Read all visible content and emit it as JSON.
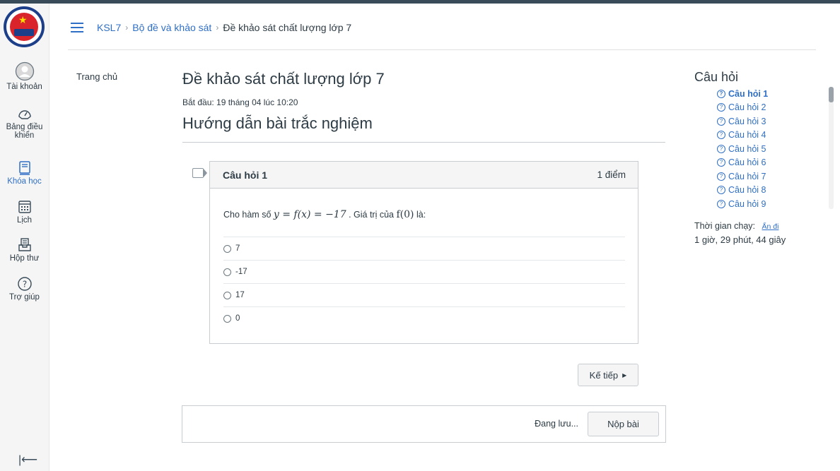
{
  "breadcrumb": {
    "course": "KSL7",
    "section": "Bộ đề và khảo sát",
    "current": "Đề khảo sát chất lượng lớp 7"
  },
  "global_nav": {
    "items": [
      {
        "label": "Tài khoản",
        "icon": "account-icon"
      },
      {
        "label": "Bảng điều khiển",
        "icon": "dashboard-icon"
      },
      {
        "label": "Khóa học",
        "icon": "courses-icon"
      },
      {
        "label": "Lịch",
        "icon": "calendar-icon"
      },
      {
        "label": "Hộp thư",
        "icon": "inbox-icon"
      },
      {
        "label": "Trợ giúp",
        "icon": "help-icon"
      }
    ],
    "active_color": "#2f6fc5"
  },
  "course_nav": {
    "home": "Trang chủ"
  },
  "quiz": {
    "title": "Đề khảo sát chất lượng lớp 7",
    "started": "Bắt đầu: 19 tháng 04 lúc 10:20",
    "instructions_heading": "Hướng dẫn bài trắc nghiệm"
  },
  "question": {
    "title": "Câu hỏi 1",
    "points": "1 điểm",
    "text_prefix": "Cho hàm số",
    "formula": "y = f(x) = −17",
    "text_mid": ". Giá trị của",
    "formula2": "f(0)",
    "text_suffix": "là:",
    "answers": [
      "7",
      "-17",
      "17",
      "0"
    ]
  },
  "buttons": {
    "next": "Kế tiếp",
    "saving": "Đang lưu...",
    "submit": "Nộp bài"
  },
  "sidebar": {
    "title": "Câu hỏi",
    "questions": [
      "Câu hỏi 1",
      "Câu hỏi 2",
      "Câu hỏi 3",
      "Câu hỏi 4",
      "Câu hỏi 5",
      "Câu hỏi 6",
      "Câu hỏi 7",
      "Câu hỏi 8",
      "Câu hỏi 9"
    ],
    "timer_label": "Thời gian chạy:",
    "hide_link": "Ẩn đi",
    "timer_value": "1 giờ, 29 phút, 44 giây"
  }
}
